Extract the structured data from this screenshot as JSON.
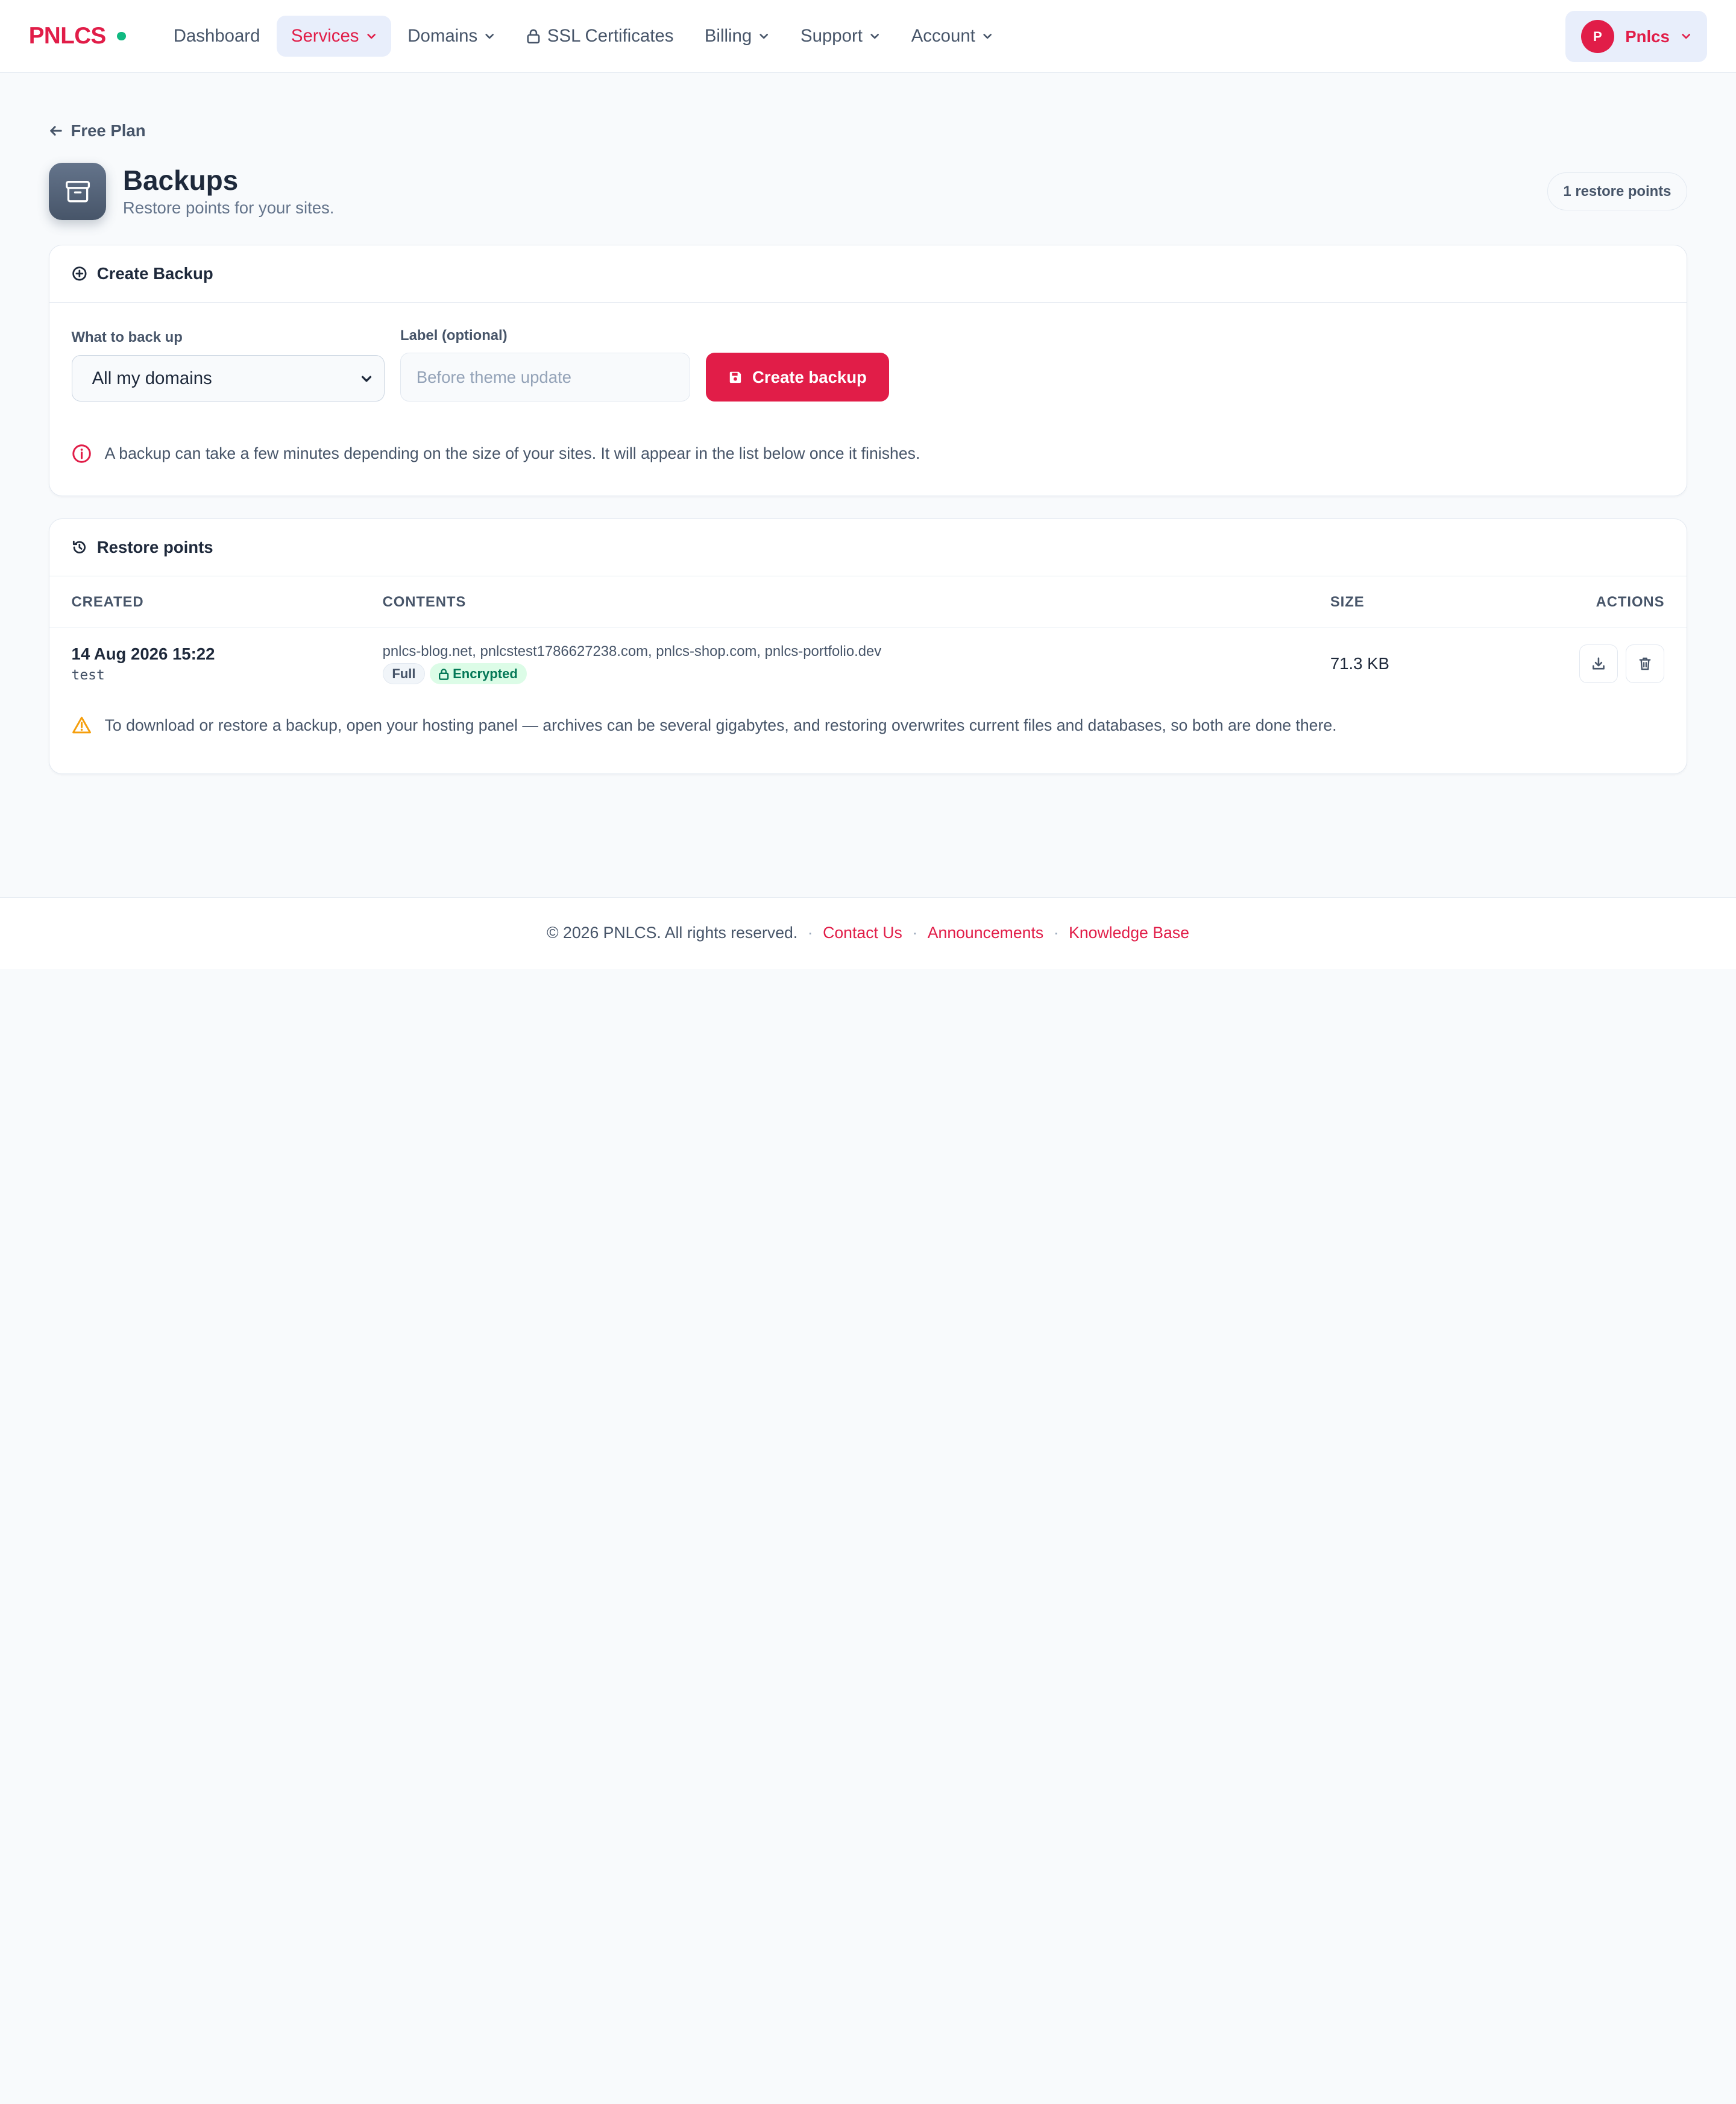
{
  "brand": {
    "name": "PNLCS",
    "accent": "#e11d48",
    "status_dot_color": "#10b981"
  },
  "nav": {
    "items": [
      {
        "label": "Dashboard",
        "has_menu": false,
        "icon": null
      },
      {
        "label": "Services",
        "has_menu": true,
        "active": true
      },
      {
        "label": "Domains",
        "has_menu": true
      },
      {
        "label": "SSL Certificates",
        "has_menu": false,
        "icon": "lock-icon"
      },
      {
        "label": "Billing",
        "has_menu": true
      },
      {
        "label": "Support",
        "has_menu": true
      },
      {
        "label": "Account",
        "has_menu": true
      }
    ]
  },
  "user": {
    "initial": "P",
    "name": "Pnlcs"
  },
  "breadcrumb": {
    "back_label": "Free Plan"
  },
  "header": {
    "icon": "archive-icon",
    "title": "Backups",
    "subtitle": "Restore points for your sites.",
    "badge": "1 restore points"
  },
  "create": {
    "title": "Create Backup",
    "what_label": "What to back up",
    "what_value": "All my domains",
    "label_label": "Label (optional)",
    "label_placeholder": "Before theme update",
    "button": "Create backup",
    "info": "A backup can take a few minutes depending on the size of your sites. It will appear in the list below once it finishes."
  },
  "restore": {
    "title": "Restore points",
    "columns": {
      "created": "CREATED",
      "contents": "CONTENTS",
      "size": "SIZE",
      "actions": "ACTIONS"
    },
    "rows": [
      {
        "created": "14 Aug 2026 15:22",
        "label": "test",
        "contents": "pnlcs-blog.net, pnlcstest1786627238.com, pnlcs-shop.com, pnlcs-portfolio.dev",
        "type_badge": "Full",
        "encryption_badge": "Encrypted",
        "size": "71.3 KB"
      }
    ],
    "warning": "To download or restore a backup, open your hosting panel — archives can be several gigabytes, and restoring overwrites current files and databases, so both are done there."
  },
  "footer": {
    "copyright": "© 2026 PNLCS. All rights reserved.",
    "links": [
      "Contact Us",
      "Announcements",
      "Knowledge Base"
    ],
    "separator": "·"
  }
}
